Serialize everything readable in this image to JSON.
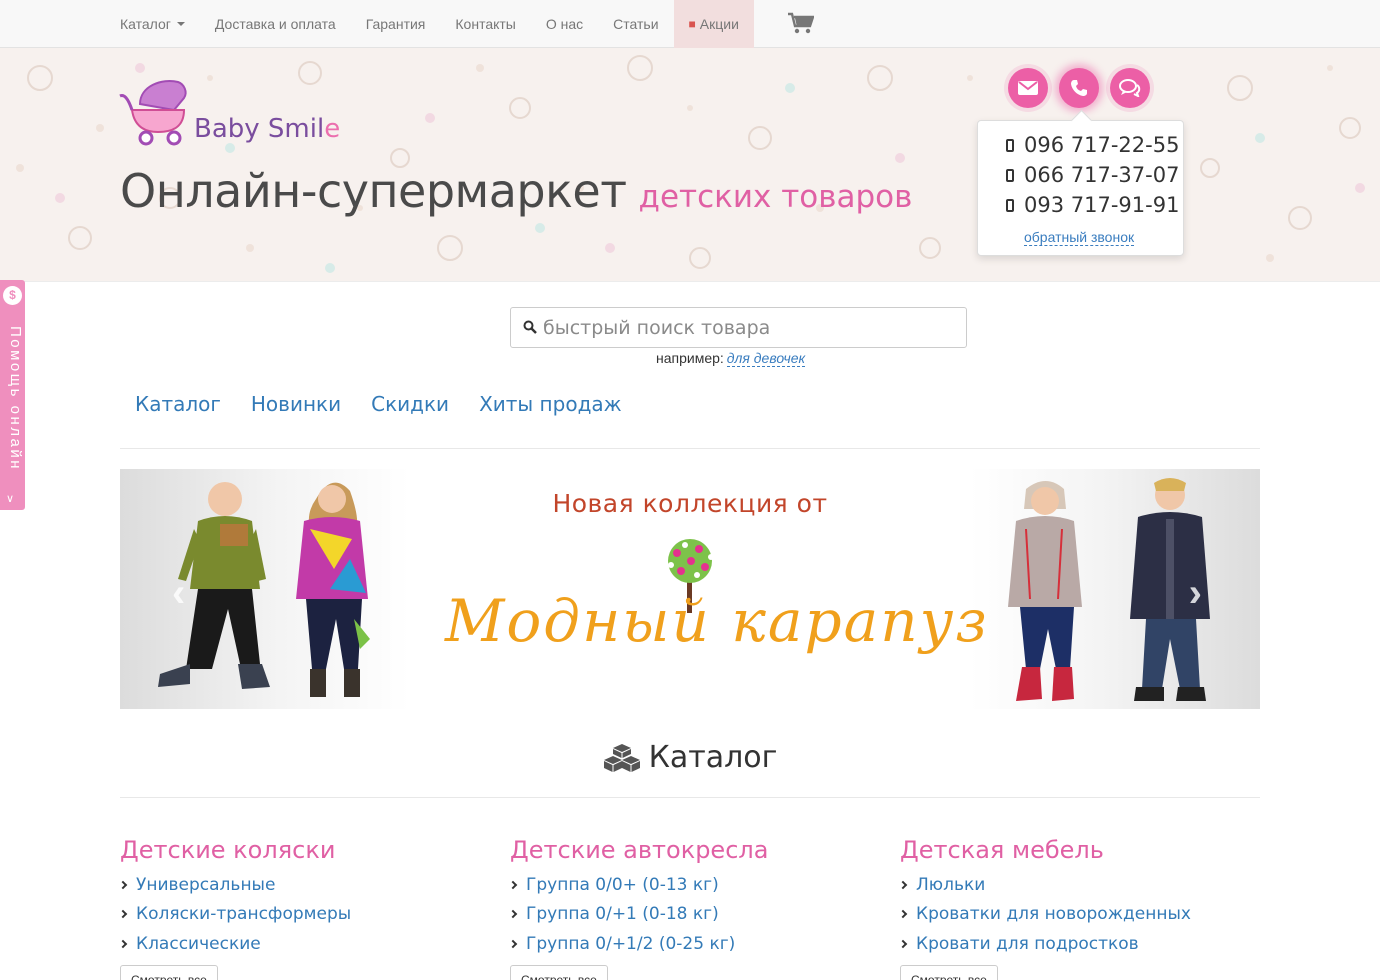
{
  "nav": {
    "items": [
      {
        "label": "Каталог",
        "dropdown": true
      },
      {
        "label": "Доставка и оплата"
      },
      {
        "label": "Гарантия"
      },
      {
        "label": "Контакты"
      },
      {
        "label": "О нас"
      },
      {
        "label": "Статьи"
      },
      {
        "label": "Акции",
        "icon": "gift-icon"
      }
    ],
    "cart_icon": "cart-icon"
  },
  "header": {
    "logo_text_main": "Baby Smil",
    "logo_text_end": "e",
    "headline_big": "Онлайн-супермаркет",
    "headline_small": "детских товаров",
    "contact_icons": [
      "envelope-icon",
      "phone-icon",
      "chat-icon"
    ],
    "phones": [
      "096 717-22-55",
      "066 717-37-07",
      "093 717-91-91"
    ],
    "callback": "обратный звонок"
  },
  "help_tab": {
    "label": "Помощь онлайн"
  },
  "search": {
    "placeholder": "быстрый поиск товара",
    "example_prefix": "например:",
    "example_link": "для девочек"
  },
  "tabs": [
    "Каталог",
    "Новинки",
    "Скидки",
    "Хиты продаж"
  ],
  "banner": {
    "title": "Новая коллекция от",
    "brand": "Модный карапуз"
  },
  "catalog": {
    "heading": "Каталог",
    "columns": [
      {
        "title": "Детские коляски",
        "items": [
          "Универсальные",
          "Коляски-трансформеры",
          "Классические"
        ],
        "more": "Смотреть все"
      },
      {
        "title": "Детские автокресла",
        "items": [
          "Группа 0/0+ (0-13 кг)",
          "Группа 0/+1 (0-18 кг)",
          "Группа 0/+1/2 (0-25 кг)"
        ],
        "more": "Смотреть все"
      },
      {
        "title": "Детская мебель",
        "items": [
          "Люльки",
          "Кроватки для новорожденных",
          "Кровати для подростков"
        ],
        "more": "Смотреть все"
      }
    ]
  },
  "colors": {
    "accent": "#e060a4",
    "link": "#337ab7",
    "promo_bg": "#f2dede"
  }
}
